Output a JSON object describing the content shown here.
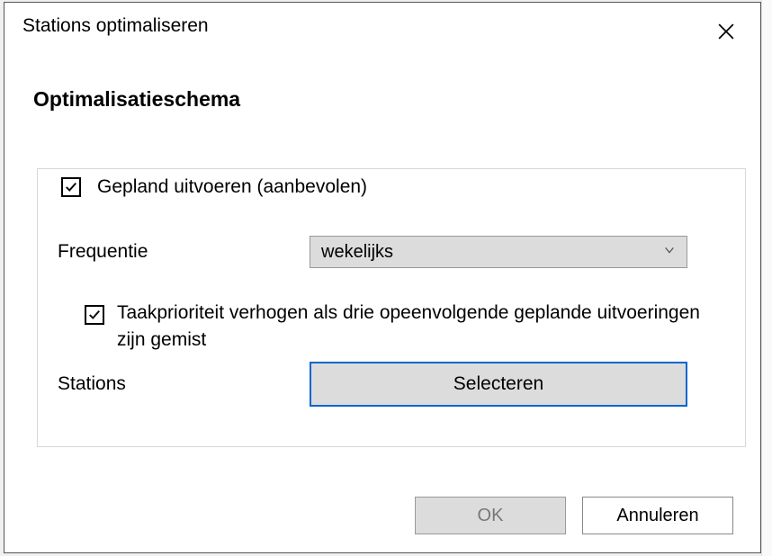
{
  "dialog": {
    "title": "Stations optimaliseren",
    "section_heading": "Optimalisatieschema",
    "scheduled_run": {
      "checked": true,
      "label": "Gepland uitvoeren (aanbevolen)"
    },
    "frequency": {
      "label": "Frequentie",
      "value": "wekelijks"
    },
    "priority": {
      "checked": true,
      "label": "Taakprioriteit verhogen als drie opeenvolgende geplande uitvoeringen zijn gemist"
    },
    "stations": {
      "label": "Stations",
      "button": "Selecteren"
    },
    "buttons": {
      "ok": "OK",
      "cancel": "Annuleren"
    }
  }
}
